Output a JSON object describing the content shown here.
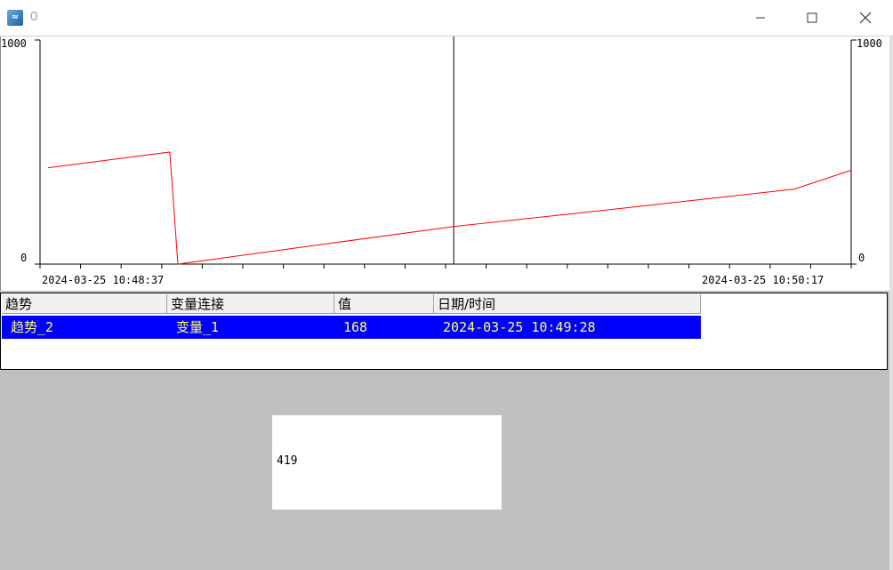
{
  "window": {
    "title": "0",
    "app_icon": "trend-app-icon"
  },
  "titlebar": {
    "minimize_icon": "minimize-icon",
    "maximize_icon": "maximize-icon",
    "close_icon": "close-icon"
  },
  "trend": {
    "y_max_label_left": "1000",
    "y_min_label_left": "0",
    "y_max_label_right": "1000",
    "y_min_label_right": "0",
    "x_start_label": "2024-03-25  10:48:37",
    "x_end_label": "2024-03-25  10:50:17",
    "line_color": "#ff0000"
  },
  "chart_data": {
    "type": "line",
    "title": "",
    "xlabel": "",
    "ylabel": "",
    "ylim": [
      0,
      1000
    ],
    "xlim": [
      "2024-03-25 10:48:37",
      "2024-03-25 10:50:17"
    ],
    "series": [
      {
        "values": [
          {
            "t": "2024-03-25 10:48:38",
            "y": 430
          },
          {
            "t": "2024-03-25 10:48:53",
            "y": 500
          },
          {
            "t": "2024-03-25 10:48:54",
            "y": 0
          },
          {
            "t": "2024-03-25 10:49:28",
            "y": 168
          },
          {
            "t": "2024-03-25 10:49:49",
            "y": 250
          },
          {
            "t": "2024-03-25 10:50:10",
            "y": 335
          },
          {
            "t": "2024-03-25 10:50:17",
            "y": 419
          }
        ]
      }
    ],
    "cursor_time": "2024-03-25 10:49:28",
    "grid": false
  },
  "table": {
    "headers": [
      "趋势",
      "变量连接",
      "值",
      "日期/时间"
    ],
    "rows": [
      {
        "trend": "趋势_2",
        "variable": "变量_1",
        "value": "168",
        "datetime": "2024-03-25 10:49:28"
      }
    ],
    "selected_row_color": "#0000ff",
    "selected_text_color": "#ffff66"
  },
  "value_display": {
    "text": "419"
  }
}
